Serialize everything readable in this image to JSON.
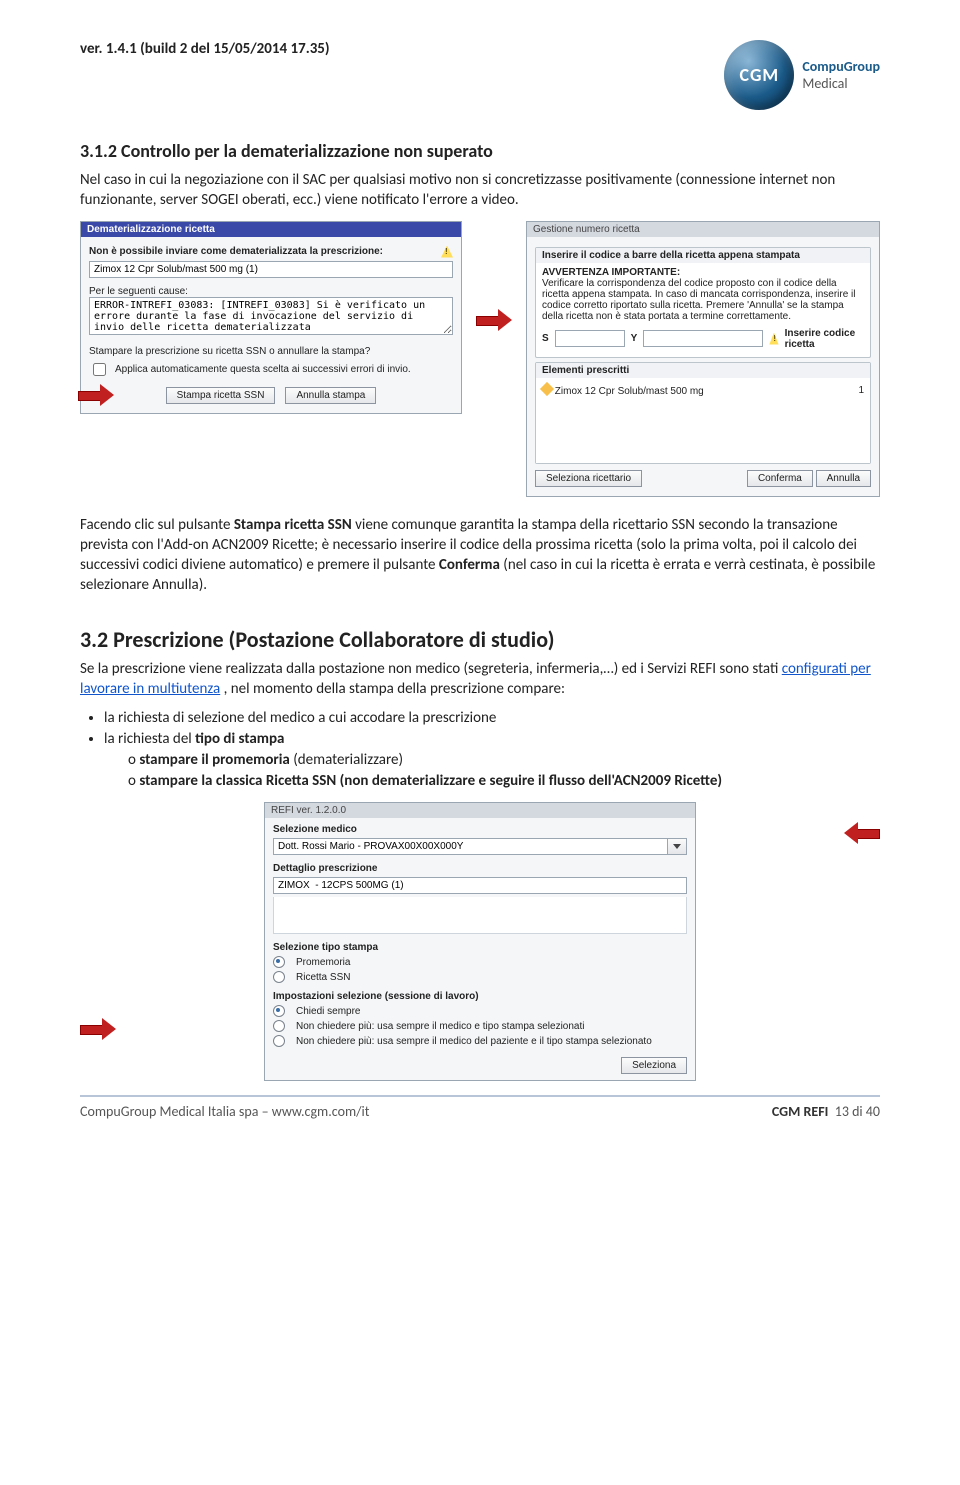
{
  "header": {
    "version_line": "ver. 1.4.1 (build 2 del 15/05/2014 17.35)",
    "logo_text": "CGM",
    "brand_top": "CompuGroup",
    "brand_sub": "Medical"
  },
  "sec312": {
    "num_title": "3.1.2   Controllo per la dematerializzazione non superato",
    "p1": "Nel caso in cui la negoziazione con il SAC per qualsiasi motivo non si concretizzasse positivamente (connessione internet non funzionante, server SOGEI oberati, ecc.) viene notificato l'errore a video."
  },
  "dlgA": {
    "title": "Dematerializzazione ricetta",
    "msg_label": "Non è possibile inviare come dematerializzata la prescrizione:",
    "prescription": "Zimox 12 Cpr Solub/mast 500 mg (1)",
    "cause_label": "Per le seguenti cause:",
    "cause_text": "ERROR-INTREFI_03083: [INTREFI_03083] Si è verificato un errore durante la fase di invocazione del servizio di invio delle ricetta dematerializzata",
    "question": "Stampare la prescrizione su ricetta SSN o annullare la stampa?",
    "checkbox": "Applica automaticamente questa scelta ai successivi errori di invio.",
    "btn_stampa": "Stampa ricetta SSN",
    "btn_annulla": "Annulla stampa"
  },
  "dlgB": {
    "title": "Gestione numero ricetta",
    "grp_barcode": "Inserire il codice a barre della ricetta appena stampata",
    "warn_head": "AVVERTENZA IMPORTANTE:",
    "warn_body": "Verificare la corrispondenza del codice proposto con il codice della ricetta appena stampata. In caso di mancata corrispondenza, inserire il codice corretto riportato sulla ricetta. Premere 'Annulla' se la stampa della ricetta non è stata portata a termine correttamente.",
    "s_label": "S",
    "y_label": "Y",
    "err_msg": "Inserire codice ricetta",
    "grp_elem": "Elementi prescritti",
    "item": "Zimox 12 Cpr Solub/mast 500 mg",
    "qty": "1",
    "btn_seleziona": "Seleziona ricettario",
    "btn_conferma": "Conferma",
    "btn_annulla": "Annulla"
  },
  "para_after_shots": {
    "t1": "Facendo clic sul pulsante ",
    "b1": "Stampa ricetta SSN",
    "t2": " viene comunque garantita la stampa della ricettario SSN secondo la transazione prevista con l'Add-on ACN2009 Ricette; è necessario inserire il codice della prossima ricetta (solo la prima volta, poi il calcolo dei successivi codici diviene automatico) e premere il pulsante ",
    "b2": "Conferma",
    "t3": " (nel caso in cui la ricetta è errata e verrà cestinata, è possibile selezionare Annulla)."
  },
  "sec32": {
    "title": "3.2  Prescrizione (Postazione Collaboratore di studio)",
    "p_before": "Se la prescrizione viene realizzata dalla postazione non medico (segreteria, infermeria,…) ed i Servizi REFI sono stati ",
    "link_text": "configurati per lavorare in multiutenza",
    "p_after": ", nel momento della stampa della prescrizione compare:",
    "li1": "la richiesta di selezione del medico a cui accodare la prescrizione",
    "li2a": "la richiesta del ",
    "li2b": "tipo di stampa",
    "sub1a": "stampare il promemoria",
    "sub1b": " (dematerializzare)",
    "sub2a": "stampare la classica Ricetta SSN (non dematerializzare e seguire il flusso dell'ACN2009 Ricette)"
  },
  "dlgC": {
    "title": "REFI  ver. 1.2.0.0",
    "lbl_sel_medico": "Selezione medico",
    "val_medico": "Dott. Rossi Mario - PROVAX00X00X000Y",
    "lbl_dettaglio": "Dettaglio prescrizione",
    "val_dettaglio": "ZIMOX  - 12CPS 500MG (1)",
    "lbl_tipo": "Selezione tipo stampa",
    "opt_promemoria": "Promemoria",
    "opt_ricetta": "Ricetta SSN",
    "lbl_imp": "Impostazioni selezione (sessione di lavoro)",
    "opt_chiedi": "Chiedi sempre",
    "opt_non1": "Non chiedere più: usa sempre il medico e tipo stampa selezionati",
    "opt_non2": "Non chiedere più: usa sempre il medico del paziente e il tipo stampa selezionato",
    "btn_seleziona": "Seleziona"
  },
  "footer": {
    "left": "CompuGroup Medical Italia spa – www.cgm.com/it",
    "right_bold": "CGM REFI",
    "right_page": "13 di 40"
  }
}
